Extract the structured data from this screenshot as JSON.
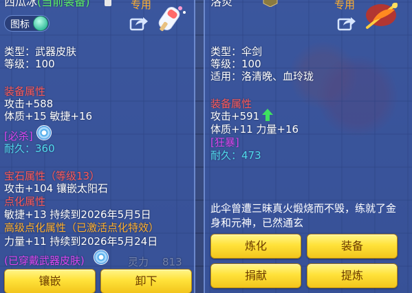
{
  "left": {
    "title_name": "西瓜冰",
    "title_equipped": "(当前装备)",
    "usable": "专用",
    "icon_toggle_label": "图标",
    "type_line": "类型：武器皮肤",
    "level_line": "等级：100",
    "equip_attr_header": "装备属性",
    "attack_line": "攻击+588",
    "stats_line": "体质+15 敏捷+16",
    "special_tag": "[必杀]",
    "durability_label": "耐久：",
    "durability_value": "360",
    "gem_header": "宝石属性（等级13）",
    "gem_line": "攻击+104 镶嵌太阳石",
    "enhance_header": "点化属性",
    "enhance_line": "敏捷+13 持续到2026年5月5日",
    "adv_enhance_header": "高级点化属性（已激活点化特效）",
    "adv_enhance_line": "力量+11 持续到2026年5月24日",
    "skin_note": "(已穿戴武器皮肤)",
    "bg_stat_label": "灵力",
    "bg_stat_value": "813",
    "buttons": {
      "inlay": "镶嵌",
      "unequip": "卸下"
    }
  },
  "right": {
    "title_name": "洛炎",
    "usable": "专用",
    "type_line": "类型：伞剑",
    "level_line": "等级：100",
    "for_line": "适用：洛清晚、血玲珑",
    "equip_attr_header": "装备属性",
    "attack_line": "攻击+591",
    "stats_line": "体质+11 力量+16",
    "special_tag": "[狂暴]",
    "durability_label": "耐久：",
    "durability_value": "473",
    "description": "此伞曾遭三昧真火煅烧而不毁，练就了金身和元神，已然通玄",
    "buttons": {
      "refine": "炼化",
      "equip": "装备",
      "donate": "捐献",
      "extract": "提炼"
    }
  },
  "colors": {
    "section_red": "#ff5a5a",
    "durability_cyan": "#52dbf0",
    "special_purple": "#d946f0",
    "enhance_orange": "#ffb030",
    "equipped_green": "#5cf06a",
    "button_yellow": "#ffe23a",
    "button_text": "#6a3a00"
  },
  "icons": [
    "share-icon",
    "ice-pop-icon",
    "fire-umbrella-icon",
    "swirl-icon",
    "up-arrow-icon",
    "lock-icon",
    "emblem-icon"
  ]
}
